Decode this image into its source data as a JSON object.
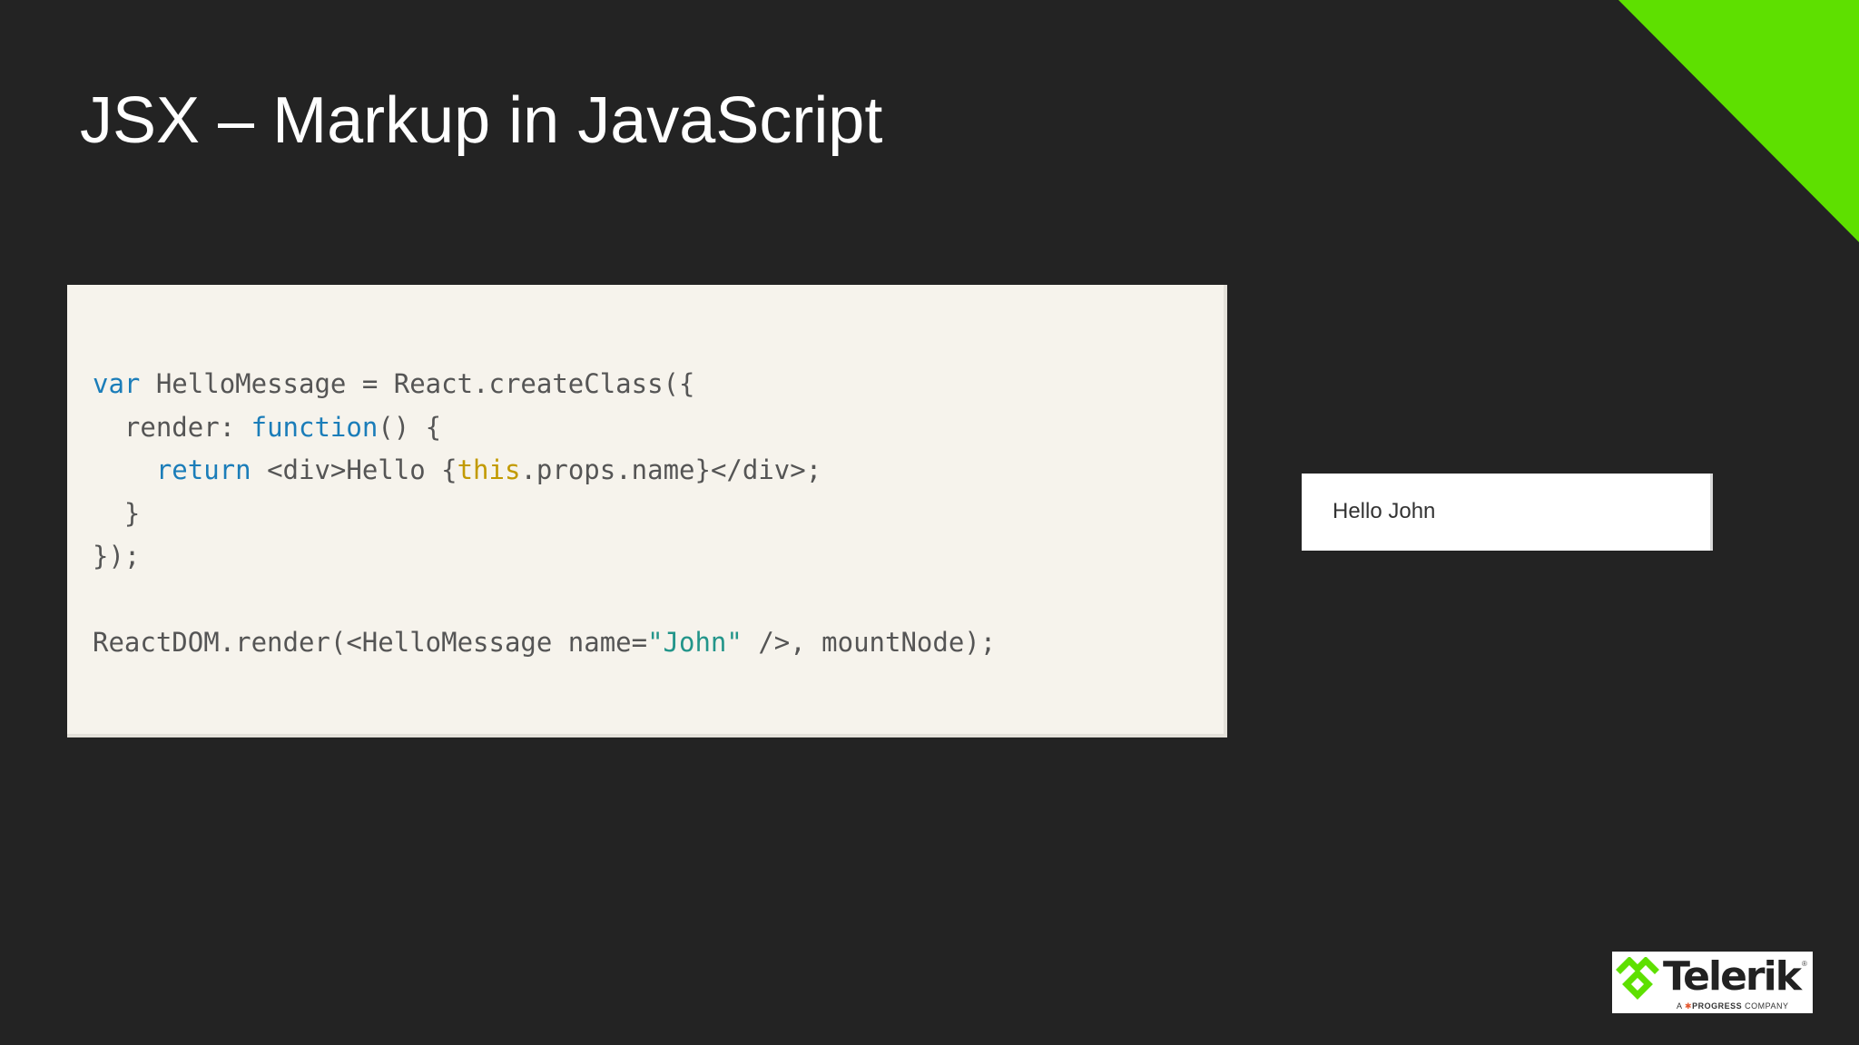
{
  "slide": {
    "title": "JSX – Markup in JavaScript"
  },
  "colors": {
    "background": "#232323",
    "accent": "#5ee000",
    "code_background": "#f6f3ec",
    "keyword": "#1b7db9",
    "this_keyword": "#c29a00",
    "string": "#23958a"
  },
  "code": {
    "lines": [
      [
        {
          "text": "var",
          "style": "keyword"
        },
        {
          "text": " HelloMessage = React.createClass({",
          "style": "plain"
        }
      ],
      [
        {
          "text": "  render: ",
          "style": "plain"
        },
        {
          "text": "function",
          "style": "keyword"
        },
        {
          "text": "() {",
          "style": "plain"
        }
      ],
      [
        {
          "text": "    ",
          "style": "plain"
        },
        {
          "text": "return",
          "style": "keyword"
        },
        {
          "text": " <div>Hello {",
          "style": "plain"
        },
        {
          "text": "this",
          "style": "this"
        },
        {
          "text": ".props.name}</div>;",
          "style": "plain"
        }
      ],
      [
        {
          "text": "  }",
          "style": "plain"
        }
      ],
      [
        {
          "text": "});",
          "style": "plain"
        }
      ],
      [
        {
          "text": "",
          "style": "plain"
        }
      ],
      [
        {
          "text": "ReactDOM.render(<HelloMessage name=",
          "style": "plain"
        },
        {
          "text": "\"John\"",
          "style": "string"
        },
        {
          "text": " />, mountNode);",
          "style": "plain"
        }
      ]
    ]
  },
  "output": {
    "text": "Hello John"
  },
  "logo": {
    "name": "Telerik",
    "trademark": "®",
    "tagline_prefix": "A",
    "tagline_brand": "PROGRESS",
    "tagline_suffix": "COMPANY",
    "icon": "telerik-logo-icon"
  }
}
